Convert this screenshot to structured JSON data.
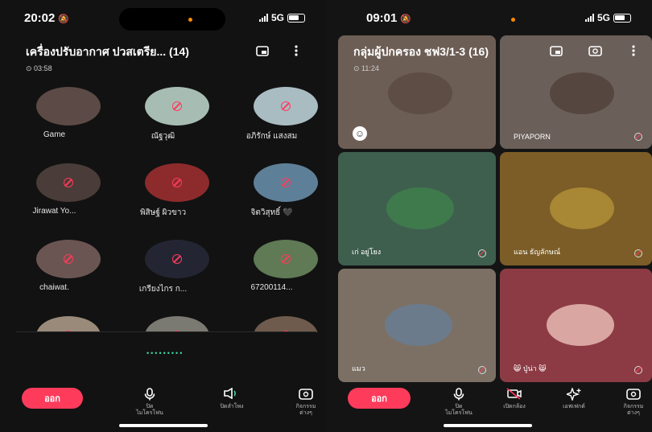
{
  "left": {
    "status": {
      "time": "20:02",
      "network": "5G"
    },
    "header": {
      "title": "เครื่องปรับอากาศ ปวสเตรีย... (14)",
      "timer": "03:58"
    },
    "participants": [
      {
        "name": "Game",
        "bg": "#5b4a45"
      },
      {
        "name": "ณัฐวุฒิ",
        "bg": "#a7bdb3"
      },
      {
        "name": "อภิรักษ์ แสงสม",
        "bg": "#a9bcc2"
      },
      {
        "name": "Jirawat Yo...",
        "bg": "#4a3c38"
      },
      {
        "name": "พิสิษฐ์ ผิวขาว",
        "bg": "#8d2b2c"
      },
      {
        "name": "จิตวิสุทธิ์ 🖤",
        "bg": "#5e7f98"
      },
      {
        "name": "chaiwat.",
        "bg": "#6b5552"
      },
      {
        "name": "เกรียงไกร ก...",
        "bg": "#232632"
      },
      {
        "name": "67200114...",
        "bg": "#5f7a55"
      },
      {
        "name": "",
        "bg": "#9a8a7a"
      },
      {
        "name": "",
        "bg": "#7b7a72"
      },
      {
        "name": "",
        "bg": "#6f5b4d"
      }
    ],
    "dots": "•••••••••",
    "controls": {
      "leave": "ออก",
      "mic": "ปิด\nไมโครโฟน",
      "speaker": "ปิดลำโพง",
      "activities": "กิจกรรม\nต่างๆ"
    }
  },
  "right": {
    "status": {
      "time": "09:01",
      "network": "5G"
    },
    "header": {
      "title": "กลุ่มผู้ปกครอง ชฟ3/1-3 (16)",
      "timer": "11:24"
    },
    "tiles": [
      {
        "name": "",
        "bg": "#6d5e55",
        "av": "#5d4d45"
      },
      {
        "name": "PIYAPORN",
        "bg": "#6b5f59",
        "av": "#55463f"
      },
      {
        "name": "เก่ อยู่โยง",
        "bg": "#3f5f4e",
        "av": "#3f7a4d"
      },
      {
        "name": "แอน ธัญลักษณ์",
        "bg": "#7c5d27",
        "av": "#a88735"
      },
      {
        "name": "แมว",
        "bg": "#7c7065",
        "av": "#6b7b8c"
      },
      {
        "name": "😸 ปู่น่า 😸",
        "bg": "#8c3b44",
        "av": "#d9a6a2"
      }
    ],
    "controls": {
      "leave": "ออก",
      "mic": "ปิด\nไมโครโฟน",
      "camera": "เปิดกล้อง",
      "effects": "เอฟเฟกต์",
      "activities": "กิจกรรม\nต่างๆ"
    }
  }
}
